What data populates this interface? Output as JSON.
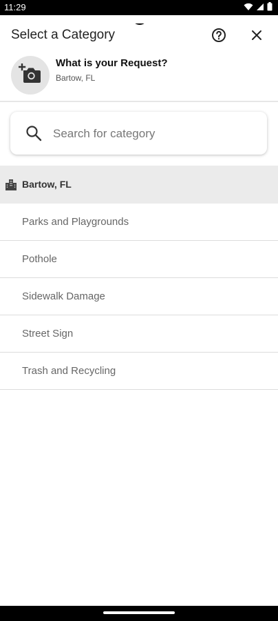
{
  "status_bar": {
    "time": "11:29"
  },
  "header": {
    "title": "Select a Category",
    "help_icon": "help-circle-icon",
    "close_icon": "close-icon"
  },
  "request": {
    "title": "What is your Request?",
    "location": "Bartow, FL",
    "avatar_icon": "add-photo-icon"
  },
  "search": {
    "placeholder": "Search for category"
  },
  "group": {
    "label": "Bartow, FL",
    "icon": "city-buildings-icon"
  },
  "categories": [
    {
      "label": "Parks and Playgrounds"
    },
    {
      "label": "Pothole"
    },
    {
      "label": "Sidewalk Damage"
    },
    {
      "label": "Street Sign"
    },
    {
      "label": "Trash and Recycling"
    }
  ]
}
